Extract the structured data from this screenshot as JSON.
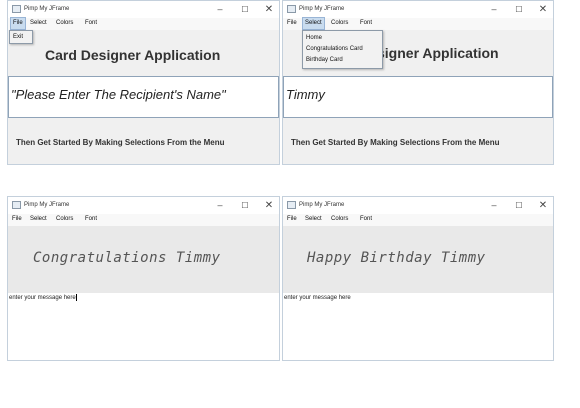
{
  "window": {
    "title": "Pimp My JFrame",
    "controls": {
      "minimize": "–",
      "maximize": "☐",
      "close": "✕"
    }
  },
  "menu": {
    "file": "File",
    "select": "Select",
    "colors": "Colors",
    "font": "Font"
  },
  "file_menu": {
    "exit": "Exit"
  },
  "select_menu": {
    "home": "Home",
    "congratulations": "Congratulations Card",
    "birthday": "Birthday Card"
  },
  "panel1": {
    "heading": "Card Designer Application",
    "name_prompt": "\"Please Enter The Recipient's Name\"",
    "instruction": "Then Get Started By Making Selections From the Menu"
  },
  "panel2": {
    "heading_visible": "signer Application",
    "name_value": "Timmy",
    "instruction": "Then Get Started By Making Selections From the Menu"
  },
  "panel3": {
    "greeting": "Congratulations Timmy",
    "message_placeholder": "enter your message here"
  },
  "panel4": {
    "greeting": "Happy Birthday Timmy",
    "message_placeholder": "enter your message here"
  },
  "colors": {
    "menu_highlight": "#c9dcef",
    "window_border": "#c4d0dc",
    "panel_bg": "#f0f0f0"
  }
}
